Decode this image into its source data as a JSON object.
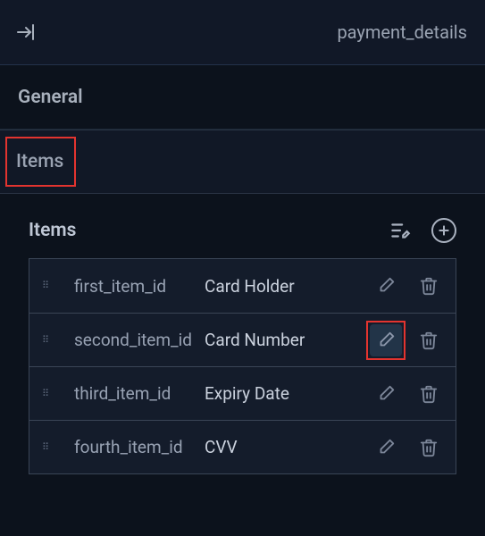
{
  "header": {
    "title": "payment_details"
  },
  "sections": {
    "general": "General",
    "items": "Items"
  },
  "panel": {
    "title": "Items"
  },
  "items": [
    {
      "id": "first_item_id",
      "label": "Card Holder"
    },
    {
      "id": "second_item_id",
      "label": "Card Number"
    },
    {
      "id": "third_item_id",
      "label": "Expiry Date"
    },
    {
      "id": "fourth_item_id",
      "label": "CVV"
    }
  ]
}
